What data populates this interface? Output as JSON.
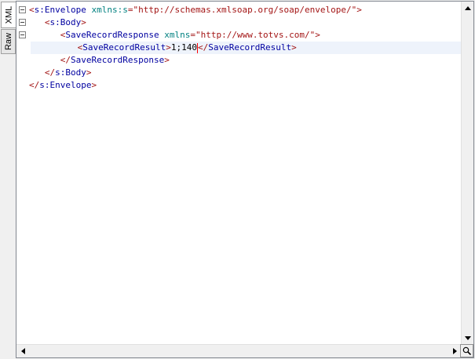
{
  "tabs": [
    {
      "label": "XML",
      "active": true
    },
    {
      "label": "Raw",
      "active": false
    }
  ],
  "code": {
    "line1": {
      "open": "<",
      "el": "s:Envelope",
      "sp": " ",
      "attr": "xmlns:s",
      "eq": "=",
      "val": "\"http://schemas.xmlsoap.org/soap/envelope/\"",
      "close": ">"
    },
    "line2": {
      "open": "<",
      "el": "s:Body",
      "close": ">"
    },
    "line3": {
      "open": "<",
      "el": "SaveRecordResponse",
      "sp": " ",
      "attr": "xmlns",
      "eq": "=",
      "val": "\"http://www.totvs.com/\"",
      "close": ">"
    },
    "line4": {
      "open": "<",
      "el": "SaveRecordResult",
      "close": ">",
      "text": "1;140",
      "open2": "</",
      "el2": "SaveRecordResult",
      "close2": ">"
    },
    "line5": {
      "open": "</",
      "el": "SaveRecordResponse",
      "close": ">"
    },
    "line6": {
      "open": "</",
      "el": "s:Body",
      "close": ">"
    },
    "line7": {
      "open": "</",
      "el": "s:Envelope",
      "close": ">"
    }
  },
  "scroll": {
    "up_icon": "triangle-up",
    "down_icon": "triangle-down",
    "left_icon": "triangle-left",
    "right_icon": "triangle-right",
    "zoom_icon": "magnifier"
  },
  "colors": {
    "tag": "#a31515",
    "element": "#0000a0",
    "attribute": "#008080",
    "caret": "#ff0000"
  }
}
